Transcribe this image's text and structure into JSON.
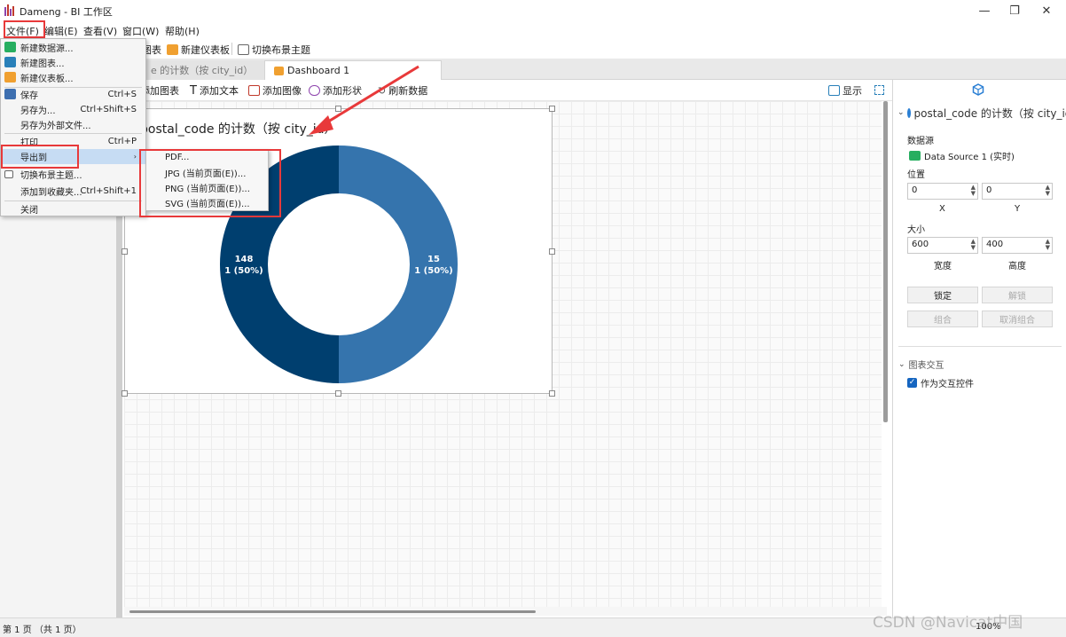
{
  "window": {
    "title": "Dameng - BI 工作区"
  },
  "menubar": [
    "文件(F)",
    "编辑(E)",
    "查看(V)",
    "窗口(W)",
    "帮助(H)"
  ],
  "toolbar": {
    "new_chart": "图表",
    "new_dashboard": "新建仪表板",
    "switch_theme": "切换布景主题"
  },
  "tabs": [
    {
      "label": "e 的计数（按 city_id）"
    },
    {
      "label": "Dashboard 1"
    }
  ],
  "canvas_toolbar": {
    "add_chart": "添加图表",
    "add_text": "添加文本",
    "add_image": "添加图像",
    "add_shape": "添加形状",
    "refresh": "刷新数据",
    "display": "显示"
  },
  "chart_data": {
    "type": "pie",
    "title": "postal_code 的计数（按 city_id）",
    "slices": [
      {
        "label": "148",
        "sublabel": "1 (50%)",
        "value": 1,
        "percent": 50,
        "color": "#003f6f"
      },
      {
        "label": "15",
        "sublabel": "1 (50%)",
        "value": 1,
        "percent": 50,
        "color": "#3574ad"
      }
    ],
    "donut": true
  },
  "right_panel": {
    "title": "postal_code 的计数（按 city_id",
    "datasource_label": "数据源",
    "datasource_value": "Data Source 1 (实时)",
    "position_label": "位置",
    "x_value": "0",
    "y_value": "0",
    "x_label": "X",
    "y_label": "Y",
    "size_label": "大小",
    "width_value": "600",
    "height_value": "400",
    "width_label": "宽度",
    "height_label": "高度",
    "lock": "锁定",
    "unlock": "解锁",
    "group": "组合",
    "ungroup": "取消组合",
    "interaction_title": "图表交互",
    "interaction_checkbox": "作为交互控件"
  },
  "file_menu": {
    "items": [
      {
        "label": "新建数据源...",
        "shortcut": ""
      },
      {
        "label": "新建图表...",
        "shortcut": ""
      },
      {
        "label": "新建仪表板...",
        "shortcut": ""
      },
      {
        "label": "保存",
        "shortcut": "Ctrl+S"
      },
      {
        "label": "另存为...",
        "shortcut": "Ctrl+Shift+S"
      },
      {
        "label": "另存为外部文件...",
        "shortcut": ""
      },
      {
        "label": "打印",
        "shortcut": "Ctrl+P"
      },
      {
        "label": "导出到",
        "shortcut": ""
      },
      {
        "label": "切换布景主题...",
        "shortcut": ""
      },
      {
        "label": "添加到收藏夹...",
        "shortcut": "Ctrl+Shift+1"
      },
      {
        "label": "关闭",
        "shortcut": ""
      }
    ]
  },
  "export_submenu": [
    "PDF...",
    "JPG (当前页面(E))...",
    "PNG (当前页面(E))...",
    "SVG (当前页面(E))..."
  ],
  "status": {
    "page": "第 1 页 （共 1 页）",
    "zoom": "100%"
  },
  "watermark": "CSDN @Navicat中国",
  "colors": {
    "accent": "#1565c0",
    "highlight_red": "#e8393a",
    "donut_dark": "#003f6f",
    "donut_light": "#3574ad"
  }
}
